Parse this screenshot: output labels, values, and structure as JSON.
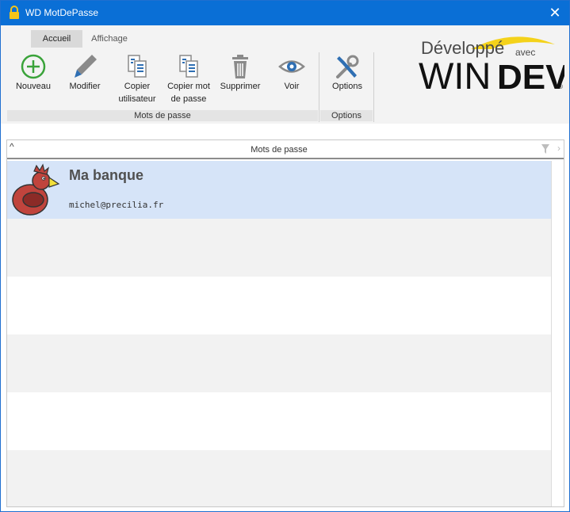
{
  "window": {
    "title": "WD MotDePasse",
    "close_glyph": "✕"
  },
  "ribbon": {
    "tabs": [
      {
        "label": "Accueil",
        "active": true
      },
      {
        "label": "Affichage",
        "active": false
      }
    ],
    "buttons": {
      "nouveau": {
        "line1": "Nouveau",
        "line2": "",
        "icon": "add-circle-icon"
      },
      "modifier": {
        "line1": "Modifier",
        "line2": "",
        "icon": "pencil-icon"
      },
      "copier_utilisateur": {
        "line1": "Copier",
        "line2": "utilisateur",
        "icon": "copy-document-icon"
      },
      "copier_mdp": {
        "line1": "Copier mot",
        "line2": "de passe",
        "icon": "copy-document-icon"
      },
      "supprimer": {
        "line1": "Supprimer",
        "line2": "",
        "icon": "trash-icon"
      },
      "voir": {
        "line1": "Voir",
        "line2": "",
        "icon": "eye-icon"
      },
      "options": {
        "line1": "Options",
        "line2": "",
        "icon": "tools-icon"
      }
    },
    "groups": {
      "passwords": "Mots de passe",
      "options": "Options"
    },
    "logo": {
      "line1": "Développé",
      "avec": "avec",
      "brand_win": "WIN",
      "brand_dev": "DEV",
      "registered": "®"
    }
  },
  "table": {
    "header": "Mots de passe",
    "sort_glyph": "^",
    "chevron_glyph": "›",
    "rows": [
      {
        "name": "Ma banque",
        "email": "michel@precilia.fr"
      }
    ]
  },
  "colors": {
    "titlebar": "#0a6fd6",
    "selected_row": "#d6e4f8",
    "add_green": "#3aa33a",
    "icon_gray": "#8a8a8a",
    "icon_blue": "#2f6fb3",
    "logo_yellow": "#f4d21a"
  }
}
